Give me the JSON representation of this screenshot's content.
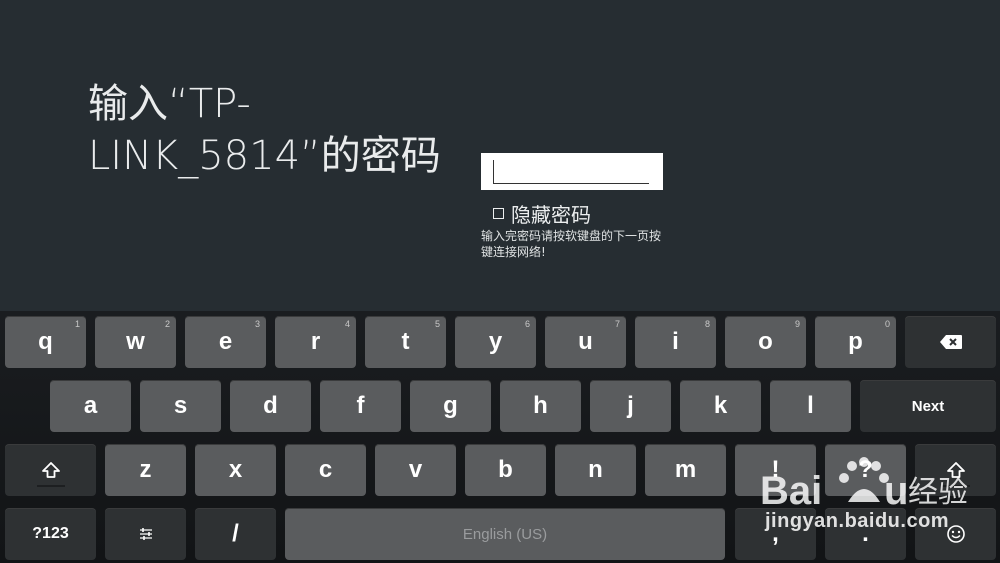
{
  "prompt": {
    "line1": "输入“TP-",
    "line2": "LINK_5814”的密码"
  },
  "password": {
    "value": "",
    "placeholder": ""
  },
  "hide_password_label": "隐藏密码",
  "hint_text": "输入完密码请按软键盘的下一页按键连接网络!",
  "keyboard": {
    "row1": [
      {
        "label": "q",
        "hint": "1"
      },
      {
        "label": "w",
        "hint": "2"
      },
      {
        "label": "e",
        "hint": "3"
      },
      {
        "label": "r",
        "hint": "4"
      },
      {
        "label": "t",
        "hint": "5"
      },
      {
        "label": "y",
        "hint": "6"
      },
      {
        "label": "u",
        "hint": "7"
      },
      {
        "label": "i",
        "hint": "8"
      },
      {
        "label": "o",
        "hint": "9"
      },
      {
        "label": "p",
        "hint": "0"
      }
    ],
    "row2": [
      "a",
      "s",
      "d",
      "f",
      "g",
      "h",
      "j",
      "k",
      "l"
    ],
    "row3": [
      "z",
      "x",
      "c",
      "v",
      "b",
      "n",
      "m",
      "!",
      "?"
    ],
    "next_label": "Next",
    "symbols_label": "?123",
    "slash_label": "/",
    "space_label": "English (US)",
    "comma_label": ",",
    "period_label": ".",
    "icons": {
      "backspace": "backspace-icon",
      "shift": "shift-icon",
      "settings": "settings-sliders-icon",
      "emoji": "emoji-icon"
    }
  },
  "watermark": {
    "url_text": "jingyan.baidu.com"
  }
}
